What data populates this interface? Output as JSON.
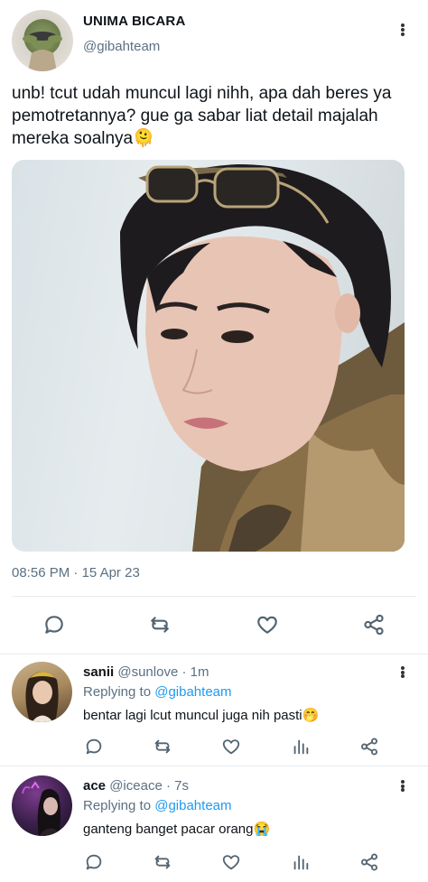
{
  "tweet": {
    "display_name": "UNIMA BICARA",
    "handle": "@gibahteam",
    "text_line1": "unb! tcut udah muncul lagi nihh, apa dah beres ya",
    "text_line2": "pemotretannya? gue ga sabar liat detail majalah",
    "text_line3": "mereka soalnya",
    "emoji": "🫠",
    "time": "08:56 PM",
    "date": "15 Apr 23"
  },
  "replies": [
    {
      "name": "sanii",
      "handle": "@sunlove",
      "age": "1m",
      "replying_prefix": "Replying to",
      "replying_to": "@gibahteam",
      "text": "bentar lagi lcut muncul juga nih pasti",
      "emoji": "🤭"
    },
    {
      "name": "ace",
      "handle": "@iceace",
      "age": "7s",
      "replying_prefix": "Replying to",
      "replying_to": "@gibahteam",
      "text": "ganteng banget pacar orang",
      "emoji": "😭"
    }
  ],
  "separators": {
    "dot": "·",
    "hair_dot": "·"
  },
  "colors": {
    "link": "#1d9bf0",
    "muted": "#5b7083",
    "icon": "#536471",
    "divider": "#e6ecf0"
  }
}
